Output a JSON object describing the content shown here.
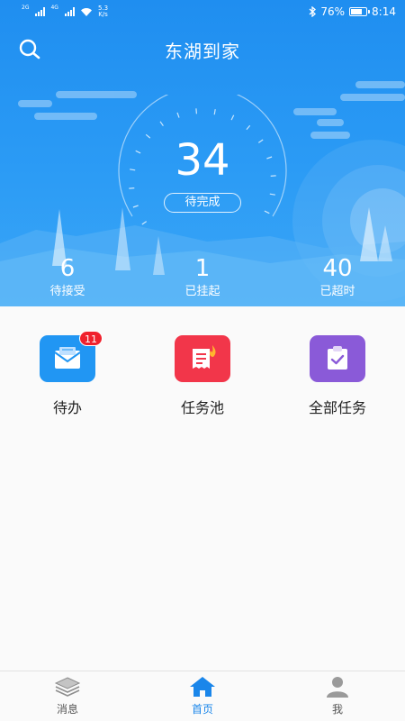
{
  "status_bar": {
    "sim1_tag": "2G",
    "sim2_tag": "4G",
    "net_speed_value": "5.3",
    "net_speed_unit": "K/s",
    "battery_percent": "76%",
    "battery_level": 0.76,
    "time": "8:14",
    "icons": [
      "signal-icon",
      "signal-icon",
      "wifi-icon",
      "bluetooth-icon",
      "battery-icon"
    ]
  },
  "header": {
    "title": "东湖到家",
    "search_icon": "search-icon"
  },
  "gauge": {
    "value": "34",
    "label": "待完成"
  },
  "stats": [
    {
      "value": "6",
      "label": "待接受"
    },
    {
      "value": "1",
      "label": "已挂起"
    },
    {
      "value": "40",
      "label": "已超时"
    }
  ],
  "entries": [
    {
      "label": "待办",
      "icon": "mail-icon",
      "badge": "11",
      "color": "#2196f3"
    },
    {
      "label": "任务池",
      "icon": "receipt-fire-icon",
      "color": "#f2364a"
    },
    {
      "label": "全部任务",
      "icon": "clipboard-check-icon",
      "color": "#8a5ad8"
    }
  ],
  "bottom_nav": [
    {
      "label": "消息",
      "icon": "layers-icon",
      "active": false
    },
    {
      "label": "首页",
      "icon": "home-icon",
      "active": true
    },
    {
      "label": "我",
      "icon": "user-icon",
      "active": false
    }
  ],
  "colors": {
    "primary": "#1f8ef0",
    "accent_active": "#1a86ea",
    "badge": "#f0212d"
  }
}
